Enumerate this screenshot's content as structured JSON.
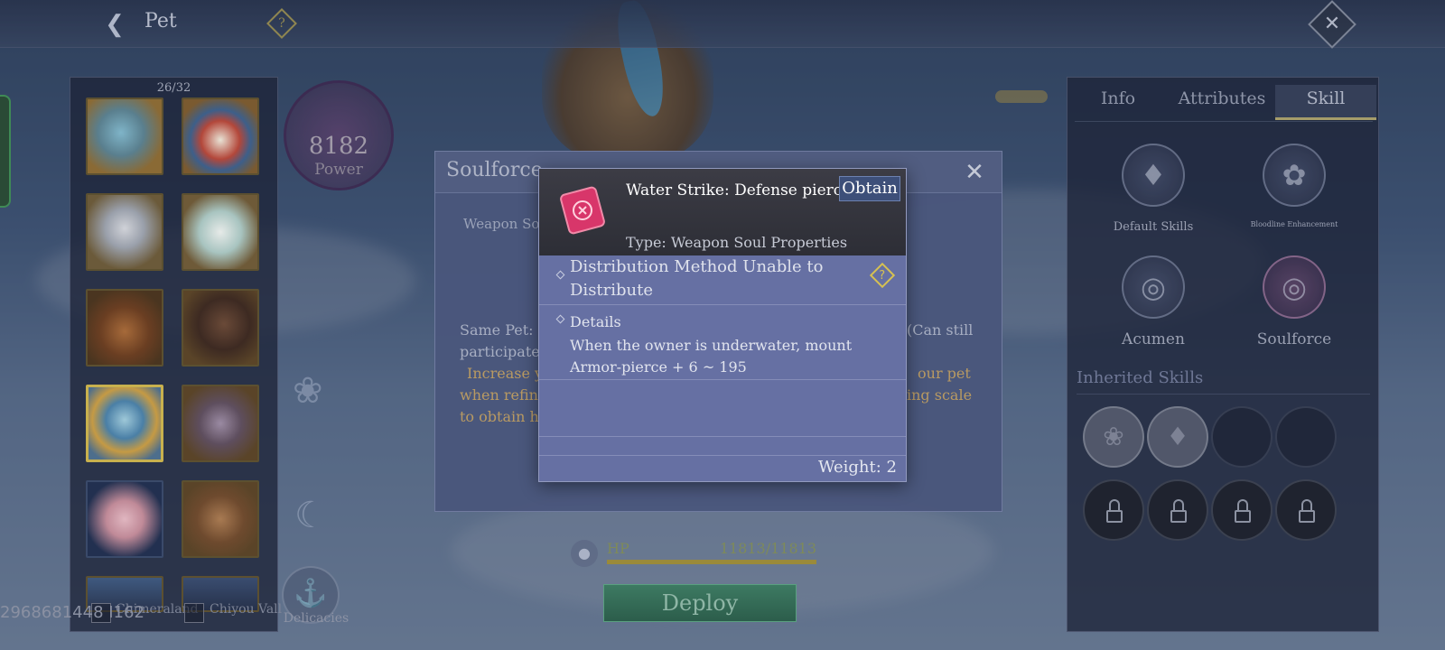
{
  "header": {
    "title": "Pet",
    "back_icon": "chevron-left-icon",
    "help_icon": "question-diamond-icon",
    "close_icon": "close-x-icon"
  },
  "pet_list": {
    "count": "26/32",
    "slots": [
      {
        "name": "azure-dragon-portrait",
        "selected": false
      },
      {
        "name": "crested-bird-portrait",
        "selected": false
      },
      {
        "name": "silver-haired-humanoid-portrait",
        "selected": false
      },
      {
        "name": "white-fox-portrait",
        "selected": false
      },
      {
        "name": "lion-beast-portrait",
        "selected": false
      },
      {
        "name": "dark-beast-portrait",
        "selected": false
      },
      {
        "name": "blue-armored-dragon-portrait",
        "selected": true
      },
      {
        "name": "mantis-creature-portrait",
        "selected": false
      },
      {
        "name": "pink-bird-portrait",
        "selected": false
      },
      {
        "name": "winged-bat-portrait",
        "selected": false
      }
    ],
    "filter_id": "2968681448 I162",
    "filters": [
      "Chimeraland",
      "Chiyou Vall"
    ]
  },
  "power": {
    "value": "8182",
    "label": "Power"
  },
  "delicacies": {
    "label": "Delicacies"
  },
  "hp": {
    "label": "HP",
    "value": "11813/11813",
    "fraction": 1.0
  },
  "deploy_label": "Deploy",
  "right_panel": {
    "tabs": [
      "Info",
      "Attributes",
      "Skill"
    ],
    "active_tab": "Skill",
    "skills": [
      {
        "label": "Default Skills",
        "icon": "lion-head-icon"
      },
      {
        "label": "Bloodline Enhancement",
        "icon": "dragon-coil-icon"
      },
      {
        "label": "Acumen",
        "icon": "spiral-icon"
      },
      {
        "label": "Soulforce",
        "icon": "soul-spiral-icon"
      }
    ],
    "inherited_title": "Inherited Skills"
  },
  "soulforce": {
    "title": "Soulforce",
    "subtitle": "Weapon Sou",
    "desc_line1": "Same Pet: C",
    "desc_right1": "(Can still",
    "desc_line2": "participate",
    "desc_orange1": "Increase y",
    "desc_orange_right1": "our pet",
    "desc_orange2": "when refin",
    "desc_orange_right2": "ing scale",
    "desc_orange3": "to obtain h"
  },
  "tooltip": {
    "item_name": "Water Strike: Defense piercing",
    "obtain_label": "Obtain",
    "type": "Type: Weapon Soul Properties",
    "distribution": "Distribution Method   Unable to Distribute",
    "details_title": "Details",
    "details_body": "When the owner is underwater, mount Armor-pierce + 6 ~ 195",
    "weight": "Weight: 2"
  },
  "colors": {
    "accent_gold": "#c8b14e",
    "tooltip_bg": "#6670a3",
    "deploy_green": "#3d7a62"
  }
}
